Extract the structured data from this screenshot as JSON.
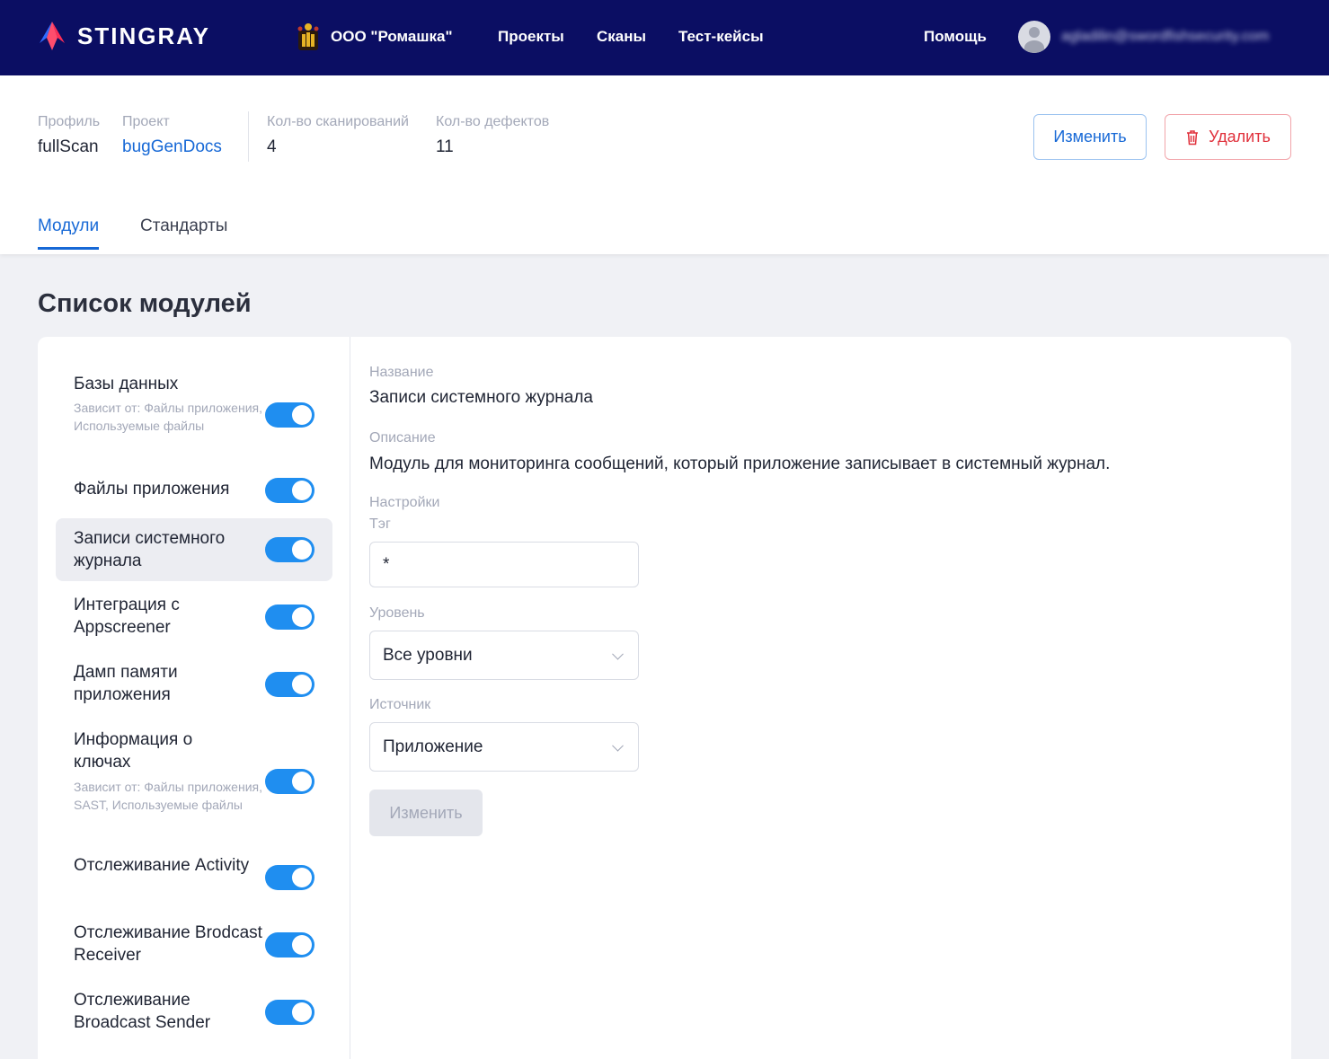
{
  "topbar": {
    "logo_text": "STINGRAY",
    "org_name": "ООО \"Ромашка\"",
    "nav": [
      "Проекты",
      "Сканы",
      "Тест-кейсы"
    ],
    "help": "Помощь",
    "user_email": "agladilin@swordfishsecurity.com"
  },
  "header": {
    "profile_label": "Профиль",
    "profile_value": "fullScan",
    "project_label": "Проект",
    "project_value": "bugGenDocs",
    "scans_label": "Кол-во сканирований",
    "scans_value": "4",
    "defects_label": "Кол-во дефектов",
    "defects_value": "11",
    "edit_button": "Изменить",
    "delete_button": "Удалить"
  },
  "tabs": [
    {
      "label": "Модули",
      "active": true
    },
    {
      "label": "Стандарты",
      "active": false
    }
  ],
  "section_title": "Список модулей",
  "modules": [
    {
      "name": "Базы данных",
      "dep": "Зависит от:  Файлы приложения, Используемые файлы",
      "enabled": true
    },
    {
      "name": "Файлы приложения",
      "dep": "",
      "enabled": true
    },
    {
      "name": "Записи системного журнала",
      "dep": "",
      "enabled": true,
      "selected": true
    },
    {
      "name": "Интеграция с Appscreener",
      "dep": "",
      "enabled": true
    },
    {
      "name": "Дамп памяти приложения",
      "dep": "",
      "enabled": true
    },
    {
      "name": "Информация о ключах",
      "dep": "Зависит от:  Файлы приложения, SAST, Используемые файлы",
      "enabled": true
    },
    {
      "name": "Отслеживание Activity",
      "dep": "",
      "enabled": true
    },
    {
      "name": "Отслеживание Brodcast Receiver",
      "dep": "",
      "enabled": true
    },
    {
      "name": "Отслеживание Broadcast Sender",
      "dep": "",
      "enabled": true
    }
  ],
  "details": {
    "name_label": "Название",
    "name_value": "Записи системного журнала",
    "desc_label": "Описание",
    "desc_value": "Модуль для мониторинга сообщений, который приложение записывает в системный журнал.",
    "settings_label": "Настройки",
    "tag_label": "Тэг",
    "tag_value": "*",
    "level_label": "Уровень",
    "level_value": "Все уровни",
    "source_label": "Источник",
    "source_value": "Приложение",
    "save_button": "Изменить"
  },
  "colors": {
    "topbar": "#0b0e63",
    "accent": "#1668d6",
    "toggle": "#1f8ef0",
    "danger": "#e0303b"
  }
}
